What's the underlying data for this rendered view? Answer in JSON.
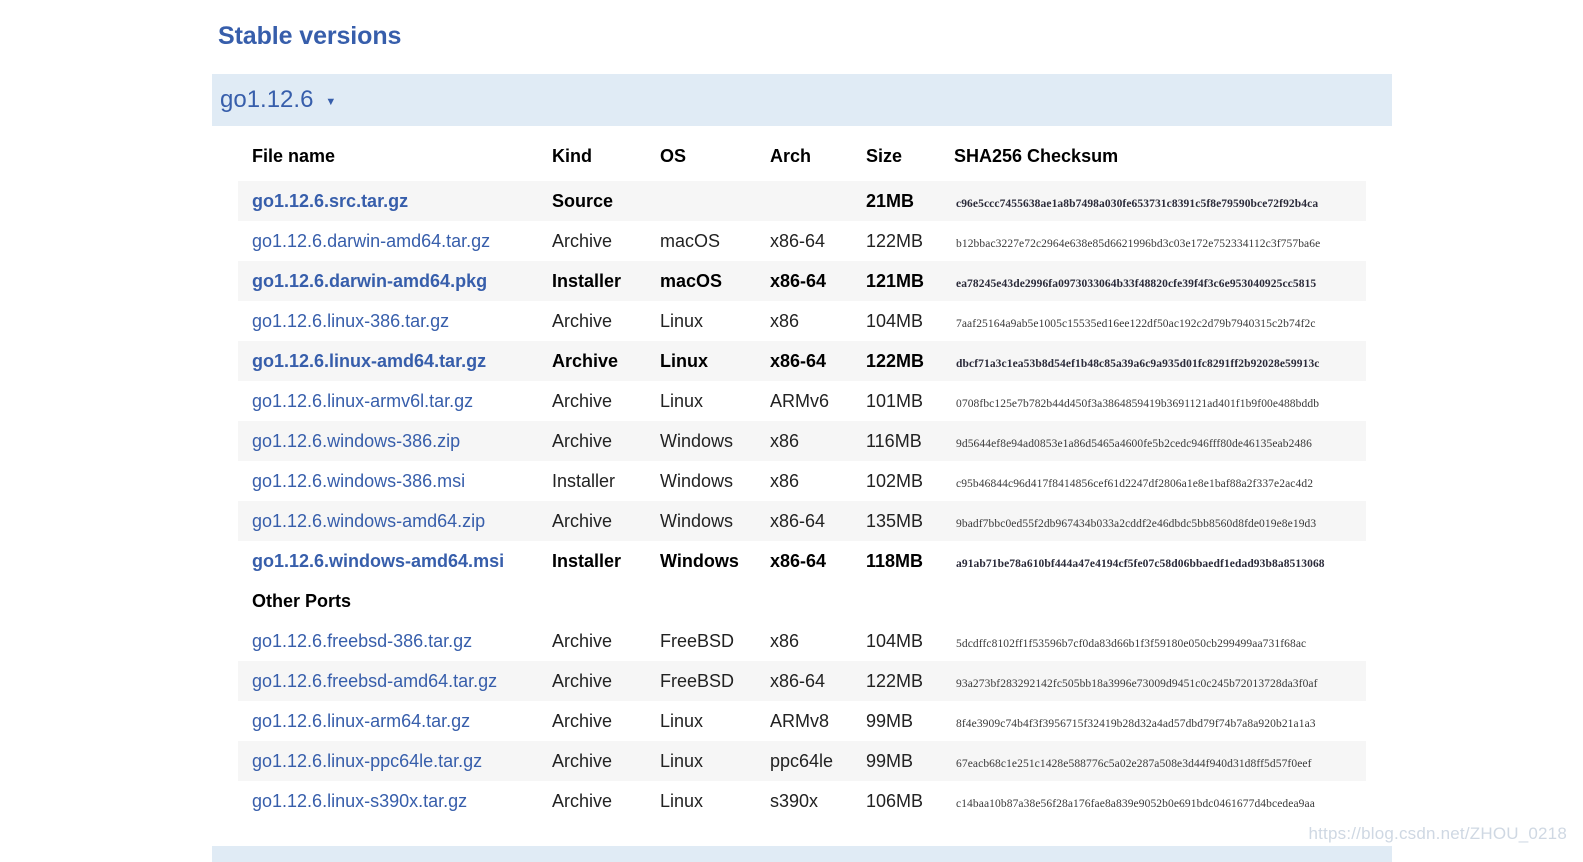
{
  "page": {
    "section_title": "Stable versions",
    "watermark": "https://blog.csdn.net/ZHOU_0218"
  },
  "version_selector": {
    "label": "go1.12.6",
    "caret": "▼"
  },
  "table": {
    "headers": {
      "file_name": "File name",
      "kind": "Kind",
      "os": "OS",
      "arch": "Arch",
      "size": "Size",
      "sha256": "SHA256 Checksum"
    },
    "group_label": "Other Ports",
    "rows": [
      {
        "file": "go1.12.6.src.tar.gz",
        "kind": "Source",
        "os": "",
        "arch": "",
        "size": "21MB",
        "sha": "c96e5ccc7455638ae1a8b7498a030fe653731c8391c5f8e79590bce72f92b4ca",
        "highlight": true,
        "shaded": true
      },
      {
        "file": "go1.12.6.darwin-amd64.tar.gz",
        "kind": "Archive",
        "os": "macOS",
        "arch": "x86-64",
        "size": "122MB",
        "sha": "b12bbac3227e72c2964e638e85d6621996bd3c03e172e752334112c3f757ba6e",
        "highlight": false,
        "shaded": false
      },
      {
        "file": "go1.12.6.darwin-amd64.pkg",
        "kind": "Installer",
        "os": "macOS",
        "arch": "x86-64",
        "size": "121MB",
        "sha": "ea78245e43de2996fa0973033064b33f48820cfe39f4f3c6e953040925cc5815",
        "highlight": true,
        "shaded": true
      },
      {
        "file": "go1.12.6.linux-386.tar.gz",
        "kind": "Archive",
        "os": "Linux",
        "arch": "x86",
        "size": "104MB",
        "sha": "7aaf25164a9ab5e1005c15535ed16ee122df50ac192c2d79b7940315c2b74f2c",
        "highlight": false,
        "shaded": false
      },
      {
        "file": "go1.12.6.linux-amd64.tar.gz",
        "kind": "Archive",
        "os": "Linux",
        "arch": "x86-64",
        "size": "122MB",
        "sha": "dbcf71a3c1ea53b8d54ef1b48c85a39a6c9a935d01fc8291ff2b92028e59913c",
        "highlight": true,
        "shaded": true
      },
      {
        "file": "go1.12.6.linux-armv6l.tar.gz",
        "kind": "Archive",
        "os": "Linux",
        "arch": "ARMv6",
        "size": "101MB",
        "sha": "0708fbc125e7b782b44d450f3a3864859419b3691121ad401f1b9f00e488bddb",
        "highlight": false,
        "shaded": false
      },
      {
        "file": "go1.12.6.windows-386.zip",
        "kind": "Archive",
        "os": "Windows",
        "arch": "x86",
        "size": "116MB",
        "sha": "9d5644ef8e94ad0853e1a86d5465a4600fe5b2cedc946fff80de46135eab2486",
        "highlight": false,
        "shaded": true
      },
      {
        "file": "go1.12.6.windows-386.msi",
        "kind": "Installer",
        "os": "Windows",
        "arch": "x86",
        "size": "102MB",
        "sha": "c95b46844c96d417f8414856cef61d2247df2806a1e8e1baf88a2f337e2ac4d2",
        "highlight": false,
        "shaded": false
      },
      {
        "file": "go1.12.6.windows-amd64.zip",
        "kind": "Archive",
        "os": "Windows",
        "arch": "x86-64",
        "size": "135MB",
        "sha": "9badf7bbc0ed55f2db967434b033a2cddf2e46dbdc5bb8560d8fde019e8e19d3",
        "highlight": false,
        "shaded": true
      },
      {
        "file": "go1.12.6.windows-amd64.msi",
        "kind": "Installer",
        "os": "Windows",
        "arch": "x86-64",
        "size": "118MB",
        "sha": "a91ab71be78a610bf444a47e4194cf5fe07c58d06bbaedf1edad93b8a8513068",
        "highlight": true,
        "shaded": false
      }
    ],
    "other_ports_rows": [
      {
        "file": "go1.12.6.freebsd-386.tar.gz",
        "kind": "Archive",
        "os": "FreeBSD",
        "arch": "x86",
        "size": "104MB",
        "sha": "5dcdffc8102ff1f53596b7cf0da83d66b1f3f59180e050cb299499aa731f68ac",
        "highlight": false,
        "shaded": false
      },
      {
        "file": "go1.12.6.freebsd-amd64.tar.gz",
        "kind": "Archive",
        "os": "FreeBSD",
        "arch": "x86-64",
        "size": "122MB",
        "sha": "93a273bf283292142fc505bb18a3996e73009d9451c0c245b72013728da3f0af",
        "highlight": false,
        "shaded": true
      },
      {
        "file": "go1.12.6.linux-arm64.tar.gz",
        "kind": "Archive",
        "os": "Linux",
        "arch": "ARMv8",
        "size": "99MB",
        "sha": "8f4e3909c74b4f3f3956715f32419b28d32a4ad57dbd79f74b7a8a920b21a1a3",
        "highlight": false,
        "shaded": false
      },
      {
        "file": "go1.12.6.linux-ppc64le.tar.gz",
        "kind": "Archive",
        "os": "Linux",
        "arch": "ppc64le",
        "size": "99MB",
        "sha": "67eacb68c1e251c1428e588776c5a02e287a508e3d44f940d31d8ff5d57f0eef",
        "highlight": false,
        "shaded": true
      },
      {
        "file": "go1.12.6.linux-s390x.tar.gz",
        "kind": "Archive",
        "os": "Linux",
        "arch": "s390x",
        "size": "106MB",
        "sha": "c14baa10b87a38e56f28a176fae8a839e9052b0e691bdc0461677d4bcedea9aa",
        "highlight": false,
        "shaded": false
      }
    ]
  },
  "colors": {
    "brand_blue": "#375EAB",
    "band_blue": "#E0EBF5",
    "row_shade": "#F6F6F6"
  }
}
